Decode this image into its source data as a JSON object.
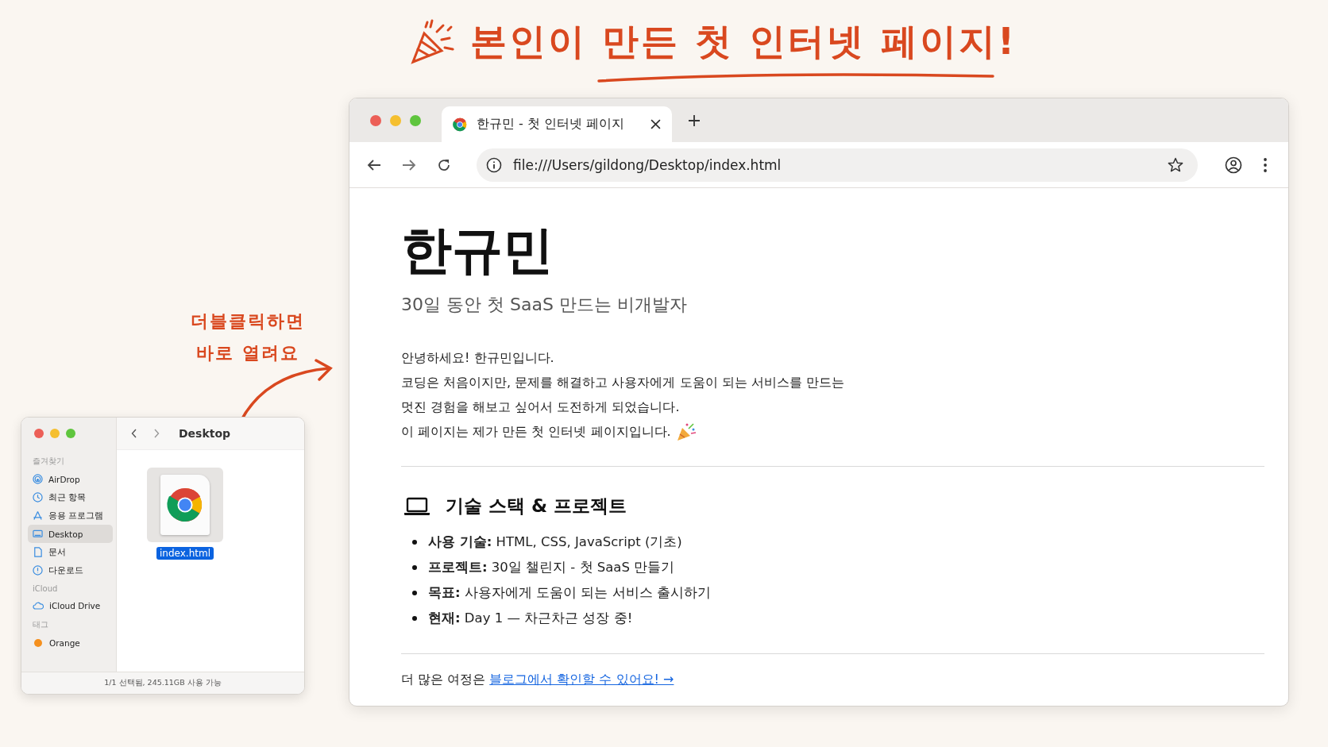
{
  "headline": {
    "text": "본인이 만든 첫 인터넷 페이지!"
  },
  "annotation": {
    "lines": [
      "더블클릭하면",
      "바로 열려요"
    ]
  },
  "finder": {
    "title": "Desktop",
    "sidebar": [
      {
        "heading": "즐겨찾기",
        "items": [
          {
            "label": "AirDrop",
            "selected": false
          },
          {
            "label": "최근 항목",
            "selected": false
          },
          {
            "label": "응용 프로그램",
            "selected": false
          },
          {
            "label": "Desktop",
            "selected": true
          },
          {
            "label": "문서",
            "selected": false
          },
          {
            "label": "다운로드",
            "selected": false
          }
        ]
      },
      {
        "heading": "iCloud",
        "items": [
          {
            "label": "iCloud Drive",
            "selected": false
          }
        ]
      },
      {
        "heading": "태그",
        "items": [
          {
            "label": "Orange",
            "selected": false,
            "color": "#f5901e"
          }
        ]
      }
    ],
    "files": [
      {
        "name": "index.html",
        "selected": true
      }
    ],
    "status_bar": "1/1 선택됨, 245.11GB 사용 가능"
  },
  "browser": {
    "tabs": [
      {
        "title": "한규민 - 첫 인터넷 페이지",
        "selected": true
      }
    ],
    "url": "file:///Users/gildong/Desktop/index.html",
    "page": {
      "name": "한규민",
      "subtitle": "30일 동안 첫 SaaS 만드는 비개발자",
      "intro": [
        "안녕하세요! 한규민입니다.",
        "코딩은 처음이지만, 문제를 해결하고 사용자에게 도움이 되는 서비스를 만드는",
        "멋진 경험을 해보고 싶어서 도전하게 되었습니다.",
        "이 페이지는 제가 만든 첫 인터넷 페이지입니다."
      ],
      "section_title": "기술 스택 & 프로젝트",
      "items": [
        "**사용 기술:** HTML, CSS, JavaScript (기초)",
        "**프로젝트:** 30일 챌린지 - 첫 SaaS 만들기",
        "**목표:** 사용자에게 도움이 되는 서비스 출시하기",
        "**현재:** Day 1 — 차근차근 성장 중!"
      ],
      "footer_text": "더 많은 여정은",
      "footer_link": "블로그에서 확인할 수 있어요! →"
    }
  }
}
